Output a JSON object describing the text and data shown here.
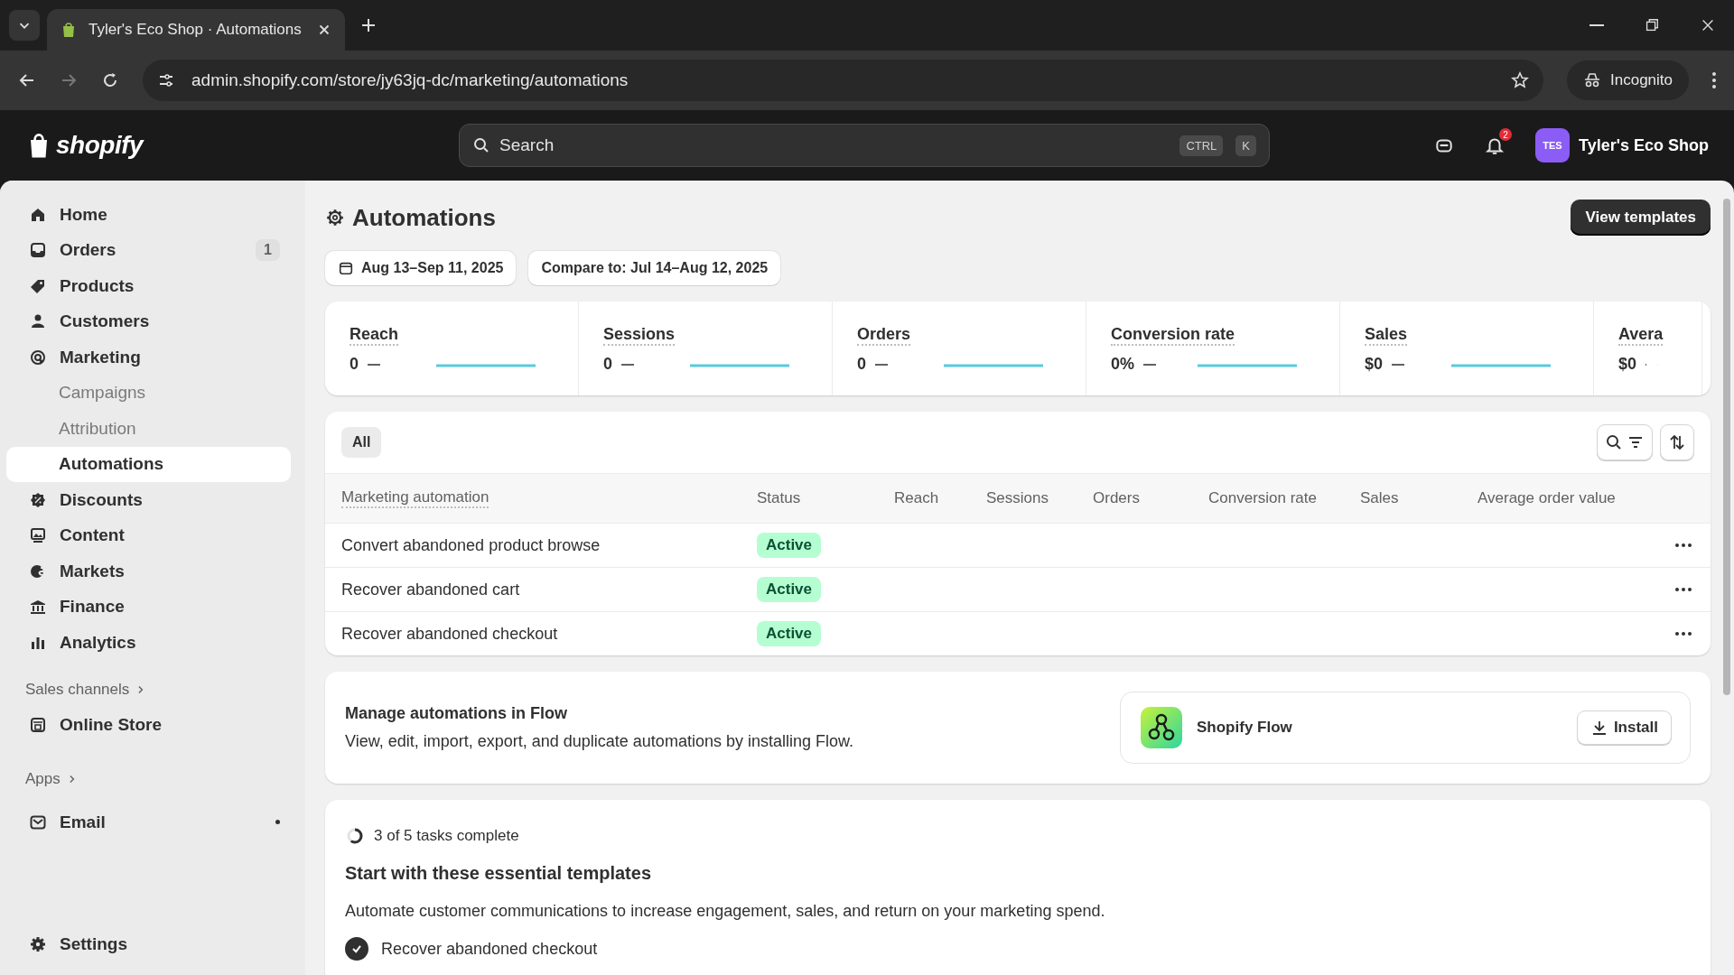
{
  "browser": {
    "tab_title": "Tyler's Eco Shop · Automations",
    "url": "admin.shopify.com/store/jy63jq-dc/marketing/automations",
    "incognito_label": "Incognito"
  },
  "header": {
    "logo_text": "shopify",
    "search_placeholder": "Search",
    "shortcut": [
      "CTRL",
      "K"
    ],
    "notification_count": "2",
    "store_initials": "TES",
    "store_name": "Tyler's Eco Shop"
  },
  "sidebar": {
    "items": [
      {
        "label": "Home",
        "selected": false
      },
      {
        "label": "Orders",
        "badge": "1",
        "selected": false
      },
      {
        "label": "Products",
        "selected": false
      },
      {
        "label": "Customers",
        "selected": false
      },
      {
        "label": "Marketing",
        "selected": false,
        "children": [
          {
            "label": "Campaigns",
            "selected": false
          },
          {
            "label": "Attribution",
            "selected": false
          },
          {
            "label": "Automations",
            "selected": true
          }
        ]
      },
      {
        "label": "Discounts",
        "selected": false
      },
      {
        "label": "Content",
        "selected": false
      },
      {
        "label": "Markets",
        "selected": false
      },
      {
        "label": "Finance",
        "selected": false
      },
      {
        "label": "Analytics",
        "selected": false
      }
    ],
    "sales_channels": {
      "title": "Sales channels",
      "items": [
        {
          "label": "Online Store",
          "selected": false
        }
      ]
    },
    "apps": {
      "title": "Apps",
      "items": [
        {
          "label": "Email",
          "selected": false,
          "unread": true
        }
      ]
    },
    "settings": {
      "label": "Settings",
      "selected": false
    }
  },
  "page": {
    "title": "Automations",
    "view_templates": "View templates",
    "date_range": "Aug 13–Sep 11, 2025",
    "compare": "Compare to: Jul 14–Aug 12, 2025"
  },
  "metrics": [
    {
      "label": "Reach",
      "value": "0"
    },
    {
      "label": "Sessions",
      "value": "0"
    },
    {
      "label": "Orders",
      "value": "0"
    },
    {
      "label": "Conversion rate",
      "value": "0%"
    },
    {
      "label": "Sales",
      "value": "$0"
    },
    {
      "label": "Avera",
      "value": "$0"
    }
  ],
  "table": {
    "filter_tabs": [
      {
        "label": "All",
        "selected": true
      }
    ],
    "columns": [
      "Marketing automation",
      "Status",
      "Reach",
      "Sessions",
      "Orders",
      "Conversion rate",
      "Sales",
      "Average order value"
    ],
    "rows": [
      {
        "name": "Convert abandoned product browse",
        "status": "Active"
      },
      {
        "name": "Recover abandoned cart",
        "status": "Active"
      },
      {
        "name": "Recover abandoned checkout",
        "status": "Active"
      }
    ]
  },
  "flow_card": {
    "title": "Manage automations in Flow",
    "description": "View, edit, import, export, and duplicate automations by installing Flow.",
    "app_name": "Shopify Flow",
    "install": "Install"
  },
  "tasks": {
    "progress": "3 of 5 tasks complete",
    "level": 0.6,
    "heading": "Start with these essential templates",
    "description": "Automate customer communications to increase engagement, sales, and return on your marketing spend.",
    "items": [
      {
        "label": "Recover abandoned checkout",
        "checked": true
      }
    ]
  }
}
